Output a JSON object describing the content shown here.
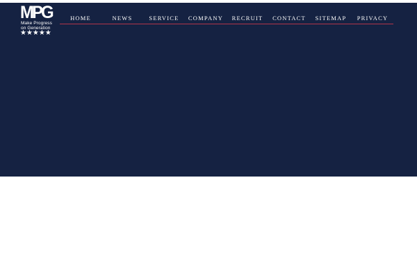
{
  "logo": {
    "mark": "MPG",
    "line1": "Make Progress",
    "line2": "on Generation",
    "stars": "★★★★★",
    "icon": "mpg-logo-icon"
  },
  "nav": {
    "items": [
      {
        "label": "HOME"
      },
      {
        "label": "NEWS"
      },
      {
        "label": "SERVICE"
      },
      {
        "label": "COMPANY"
      },
      {
        "label": "RECRUIT"
      },
      {
        "label": "CONTACT"
      },
      {
        "label": "SITEMAP"
      },
      {
        "label": "PRIVACY"
      }
    ]
  },
  "colors": {
    "hero_background": "#152242",
    "nav_rule": "#b3354a",
    "page_background": "#ffffff"
  }
}
